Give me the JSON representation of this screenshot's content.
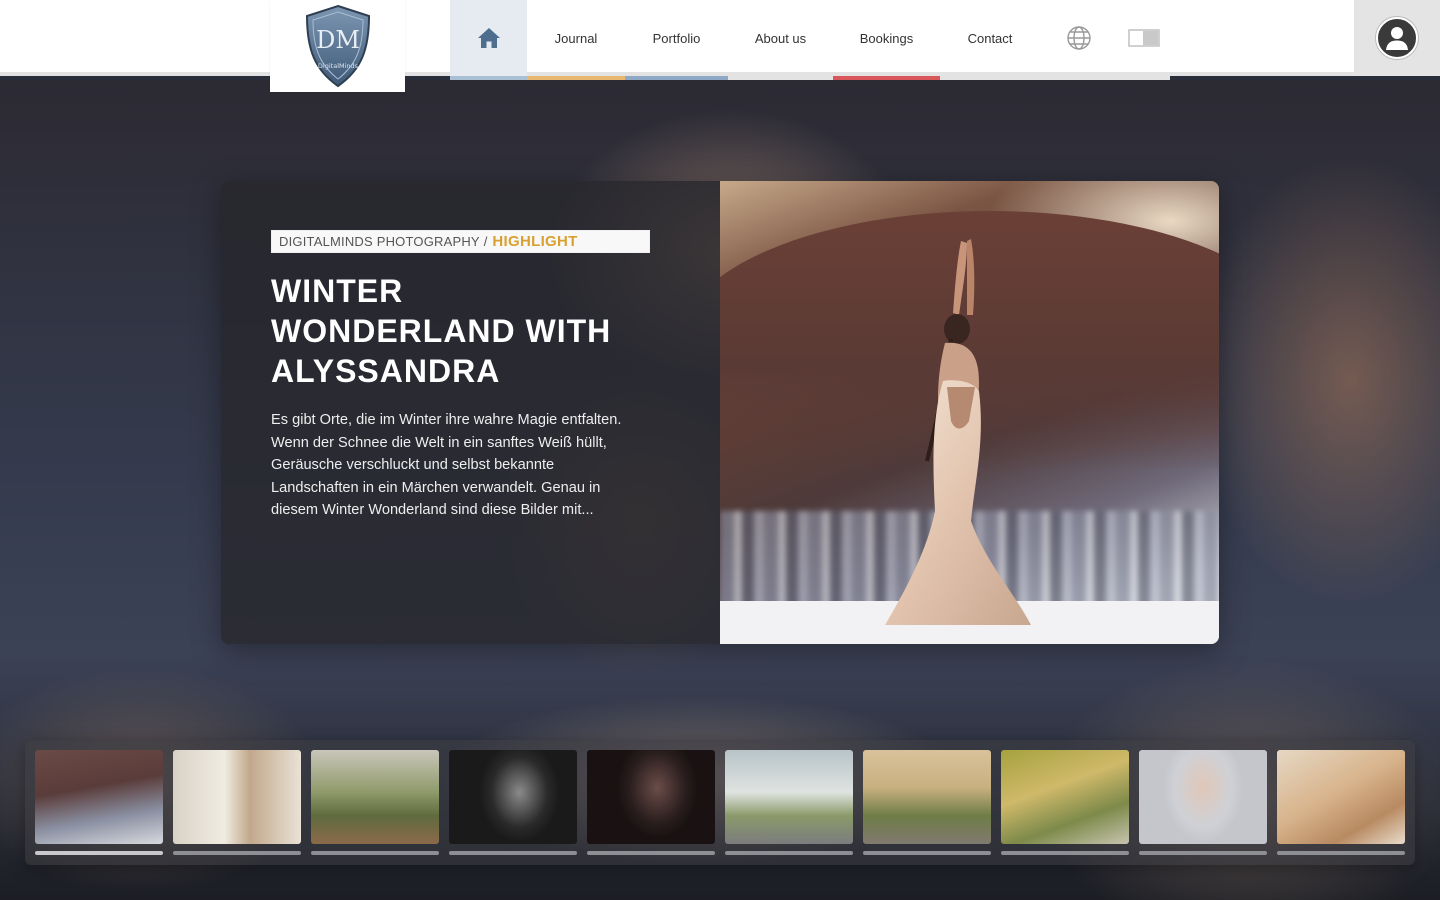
{
  "header": {
    "logo_text": "DigitalMinds",
    "logo_monogram": "DM",
    "nav": [
      {
        "id": "home",
        "label": "",
        "icon": "home-icon"
      },
      {
        "id": "journal",
        "label": "Journal"
      },
      {
        "id": "portfolio",
        "label": "Portfolio"
      },
      {
        "id": "about",
        "label": "About us"
      },
      {
        "id": "bookings",
        "label": "Bookings"
      },
      {
        "id": "contact",
        "label": "Contact"
      },
      {
        "id": "language",
        "label": "",
        "icon": "globe-icon"
      },
      {
        "id": "theme",
        "label": "",
        "icon": "theme-toggle-icon"
      }
    ],
    "user_icon": "user-icon"
  },
  "hero": {
    "breadcrumb_site": "DIGITALMINDS PHOTOGRAPHY",
    "breadcrumb_sep": "/",
    "breadcrumb_category": "HIGHLIGHT",
    "title": "WINTER WONDERLAND WITH ALYSSANDRA",
    "excerpt": "Es gibt Orte, die im Winter ihre wahre Magie entfalten. Wenn der Schnee die Welt in ein sanftes Weiß hüllt, Geräusche verschluckt und selbst bekannte Landschaften in ein Märchen verwandelt. Genau in diesem Winter Wonderland sind diese Bilder mit..."
  },
  "colors": {
    "accent_gold": "#d9a032",
    "journal": "#e8b870",
    "portfolio": "#8ea8c6",
    "bookings": "#d9575a",
    "home": "#a9bfd3"
  },
  "thumbnails": [
    {
      "name": "thumb-winter-wonderland",
      "active": true,
      "bg": "linear-gradient(170deg,#6a4a46 0%,#5a3c3a 40%,#8a90a2 70%,#d8d9de 100%)"
    },
    {
      "name": "thumb-window-portrait",
      "active": false,
      "bg": "linear-gradient(90deg,#d8d2c6 0%,#f1ece2 40%,#c2a88c 60%,#e9e2d6 100%)"
    },
    {
      "name": "thumb-vineyard-terrace",
      "active": false,
      "bg": "linear-gradient(180deg,#c9c6ba 0%,#8f9a6a 45%,#5f6a3e 70%,#8c6a4a 100%)"
    },
    {
      "name": "thumb-bw-portrait",
      "active": false,
      "bg": "radial-gradient(ellipse 40px 50px at 55% 45%,#8a8a8a,#2a2a2a 70%,#1a1a1a 100%)"
    },
    {
      "name": "thumb-dark-portrait",
      "active": false,
      "bg": "radial-gradient(ellipse 40px 50px at 55% 40%,#6a4d48,#2a1e1e 70%,#1a1212 100%)"
    },
    {
      "name": "thumb-red-dress-street",
      "active": false,
      "bg": "linear-gradient(180deg,#b8c4c8 0%,#dfe3e0 45%,#8a9a6a 70%,#7c7c7e 100%)"
    },
    {
      "name": "thumb-red-dress-garden",
      "active": false,
      "bg": "linear-gradient(180deg,#d9c29a 0%,#c8b080 40%,#6f7c46 70%,#807a70 100%)"
    },
    {
      "name": "thumb-water-splash",
      "active": false,
      "bg": "linear-gradient(160deg,#a6a23e 0%,#cfb96a 40%,#7d8a4a 70%,#c7c4b0 100%)"
    },
    {
      "name": "thumb-studio-portrait",
      "active": false,
      "bg": "radial-gradient(ellipse 40px 55px at 50% 40%,#e0c7b8,#cfd1d6 70%,#c4c6cb 100%)"
    },
    {
      "name": "thumb-candle-portrait",
      "active": false,
      "bg": "linear-gradient(150deg,#e6d8c4 0%,#d8b48c 45%,#b88a62 75%,#e9dccb 100%)"
    }
  ]
}
